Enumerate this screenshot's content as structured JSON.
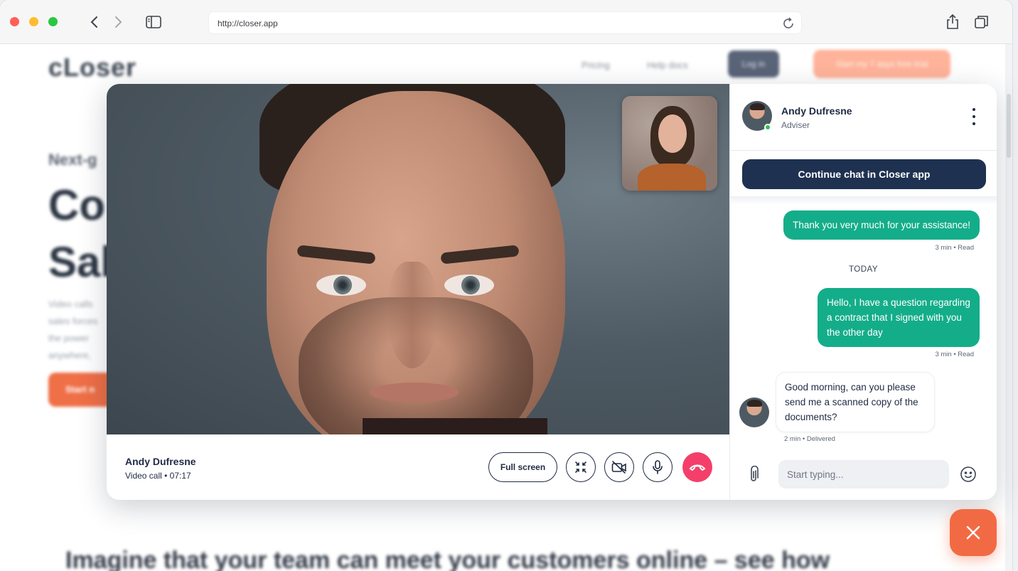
{
  "browser": {
    "url": "http://closer.app"
  },
  "site": {
    "logo": "cLoser",
    "nav": {
      "pricing": "Pricing",
      "help": "Help docs",
      "login": "Log in",
      "trial": "Start my 7 days free trial"
    },
    "hero_eyebrow": "Next-g",
    "hero_line1": "Co",
    "hero_line2": "Sal",
    "hero_p": [
      "Video calls",
      "sales forces",
      "the power",
      "anywhere,"
    ],
    "hero_cta": "Start n",
    "tagline": "Imagine that your team can meet your customers online – see how"
  },
  "call": {
    "caller_name": "Andy Dufresne",
    "caller_status": "Video call • 07:17",
    "fullscreen_label": "Full screen"
  },
  "chat": {
    "agent_name": "Andy Dufresne",
    "agent_role": "Adviser",
    "continue_label": "Continue chat in Closer app",
    "messages": [
      {
        "text": "Thank you very much for your assistance!",
        "meta": "3 min • Read"
      },
      {
        "text": "Hello, I have a question regarding a contract that I signed with you the other day",
        "meta": "3 min • Read"
      },
      {
        "text": "Good morning, can you please send me a scanned copy of the documents?",
        "meta": "2 min • Delivered"
      }
    ],
    "divider": "TODAY",
    "composer_placeholder": "Start typing..."
  },
  "colors": {
    "accent_orange": "#f26a43",
    "navy": "#1e3150",
    "bubble_green": "#14ad8a",
    "hangup_red": "#f43f6a",
    "online_green": "#2ec14f"
  },
  "icons": [
    "back-icon",
    "forward-icon",
    "sidebar-icon",
    "reload-icon",
    "share-icon",
    "tabs-icon",
    "collapse-icon",
    "camera-off-icon",
    "mic-icon",
    "hangup-icon",
    "more-icon",
    "attach-icon",
    "emoji-icon",
    "close-icon"
  ]
}
